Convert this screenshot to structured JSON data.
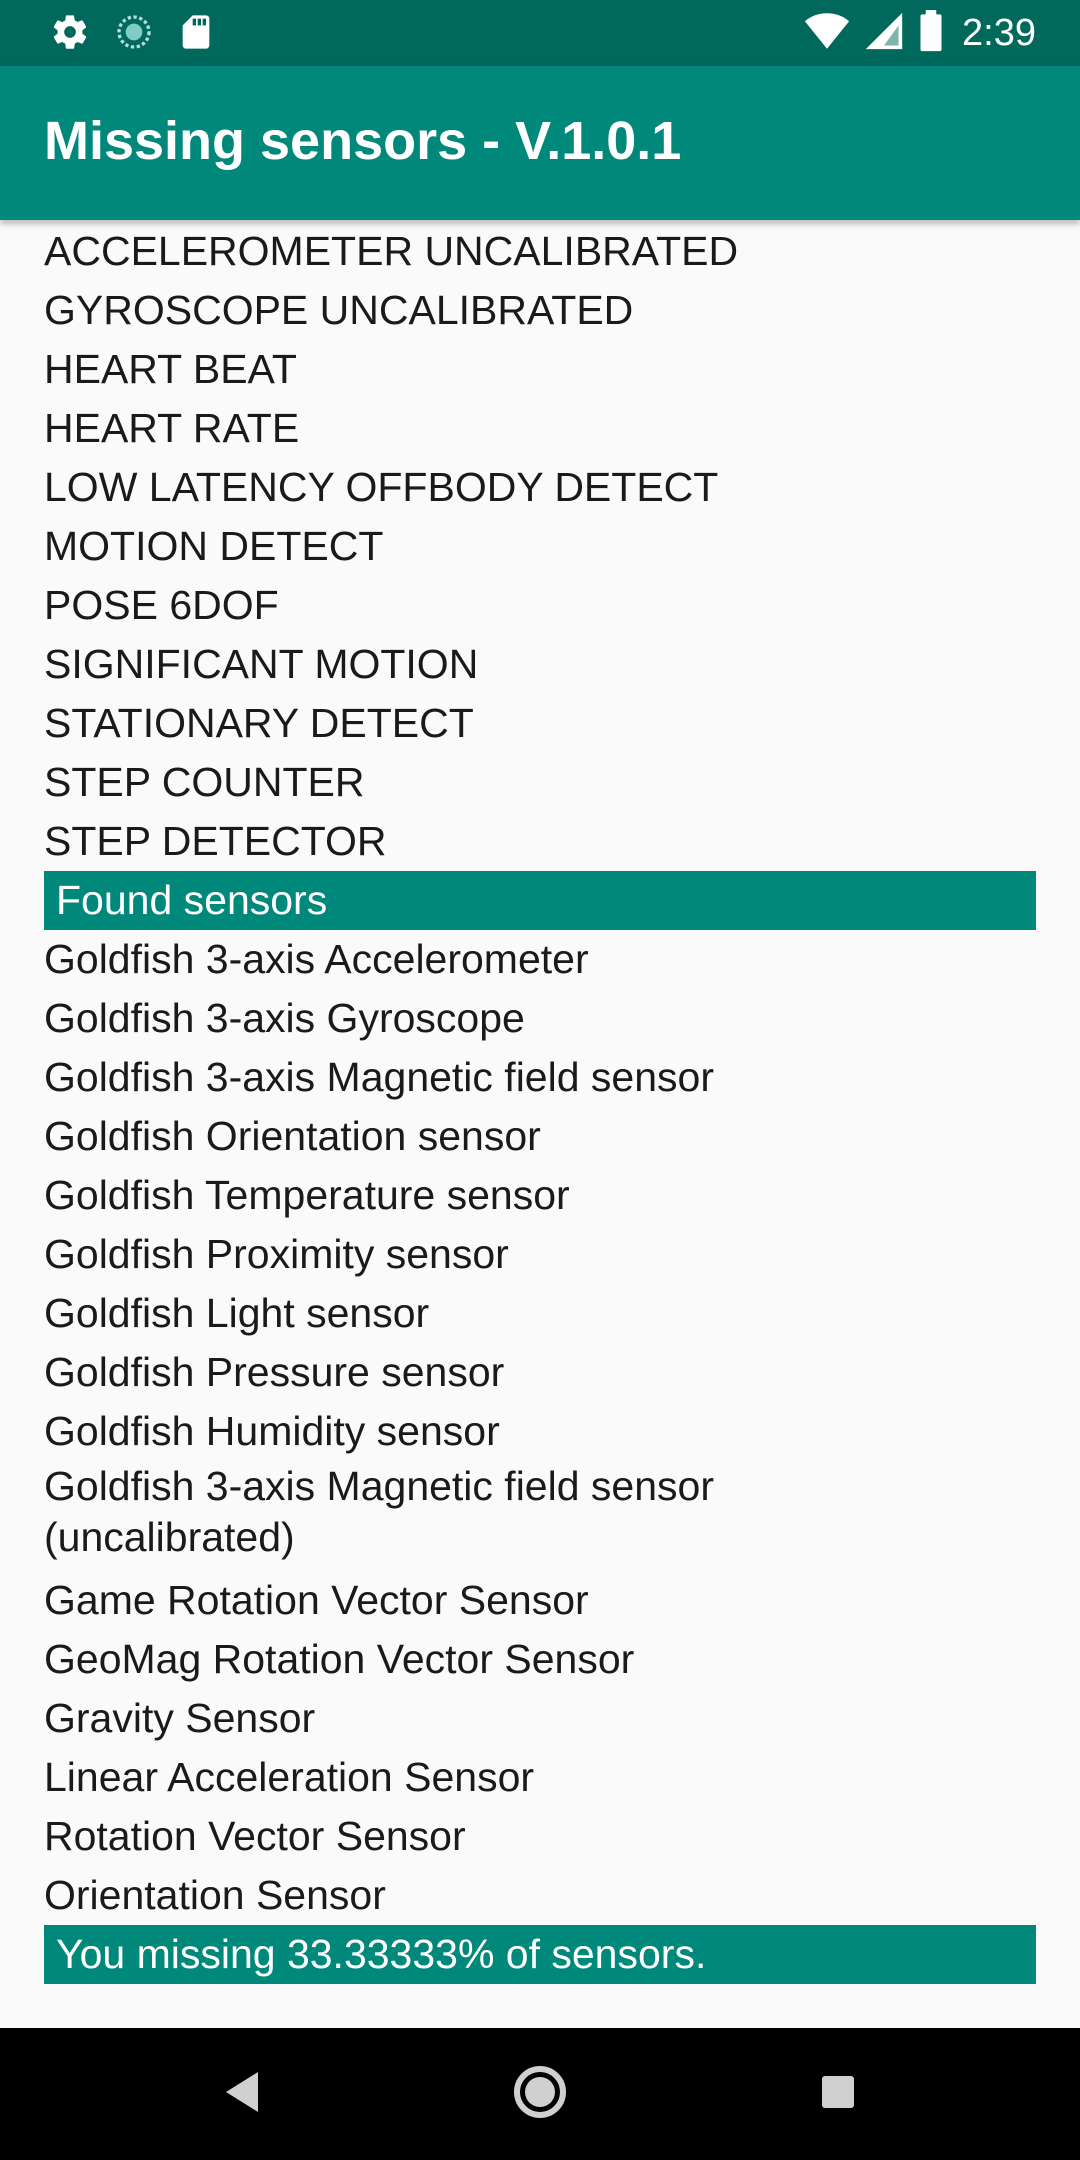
{
  "status_bar": {
    "time": "2:39",
    "icons": [
      "gear-icon",
      "sync-icon",
      "sd-card-icon",
      "wifi-icon",
      "signal-icon",
      "battery-icon"
    ]
  },
  "app_bar": {
    "title": "Missing sensors - V.1.0.1"
  },
  "missing_sensors": [
    "ACCELEROMETER UNCALIBRATED",
    "GYROSCOPE UNCALIBRATED",
    "HEART BEAT",
    "HEART RATE",
    "LOW LATENCY OFFBODY DETECT",
    "MOTION DETECT",
    "POSE 6DOF",
    "SIGNIFICANT MOTION",
    "STATIONARY DETECT",
    "STEP COUNTER",
    "STEP DETECTOR"
  ],
  "found_header": "Found sensors",
  "found_sensors": [
    "Goldfish 3-axis Accelerometer",
    "Goldfish 3-axis Gyroscope",
    "Goldfish 3-axis Magnetic field sensor",
    "Goldfish Orientation sensor",
    "Goldfish Temperature sensor",
    "Goldfish Proximity sensor",
    "Goldfish Light sensor",
    "Goldfish Pressure sensor",
    "Goldfish Humidity sensor",
    "Goldfish 3-axis Magnetic field sensor (uncalibrated)",
    "Game Rotation Vector Sensor",
    "GeoMag Rotation Vector Sensor",
    "Gravity Sensor",
    "Linear Acceleration Sensor",
    "Rotation Vector Sensor",
    "Orientation Sensor"
  ],
  "summary": "You missing 33.33333% of sensors.",
  "colors": {
    "status_bar": "#00695c",
    "app_bar": "#00897b",
    "banner": "#00897b"
  },
  "nav_bar": {
    "icons": [
      "back-icon",
      "home-icon",
      "recents-icon"
    ]
  }
}
